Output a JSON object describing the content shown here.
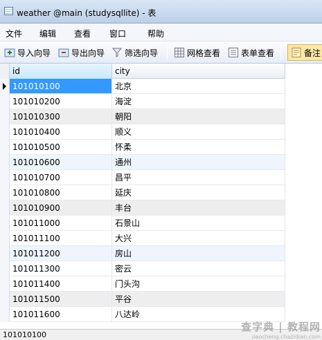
{
  "window": {
    "title": "weather @main (studysqllite) - 表"
  },
  "menu": {
    "items": [
      "文件",
      "编辑",
      "查看",
      "窗口",
      "帮助"
    ]
  },
  "toolbar": {
    "import_label": "导入向导",
    "export_label": "导出向导",
    "filter_label": "筛选向导",
    "grid_view_label": "网格查看",
    "form_view_label": "表单查看",
    "memo_label": "备注"
  },
  "table": {
    "columns": [
      "id",
      "city"
    ],
    "rows": [
      [
        "101010100",
        "北京"
      ],
      [
        "101010200",
        "海淀"
      ],
      [
        "101010300",
        "朝阳"
      ],
      [
        "101010400",
        "顺义"
      ],
      [
        "101010500",
        "怀柔"
      ],
      [
        "101010600",
        "通州"
      ],
      [
        "101010700",
        "昌平"
      ],
      [
        "101010800",
        "延庆"
      ],
      [
        "101010900",
        "丰台"
      ],
      [
        "101011000",
        "石景山"
      ],
      [
        "101011100",
        "大兴"
      ],
      [
        "101011200",
        "房山"
      ],
      [
        "101011300",
        "密云"
      ],
      [
        "101011400",
        "门头沟"
      ],
      [
        "101011500",
        "平谷"
      ],
      [
        "101011600",
        "八达岭"
      ]
    ]
  },
  "status": {
    "current_value": "101010100"
  },
  "watermark": {
    "line1": "查字典 | 教程网",
    "line2": "jiaocheng.chazidian.com"
  }
}
